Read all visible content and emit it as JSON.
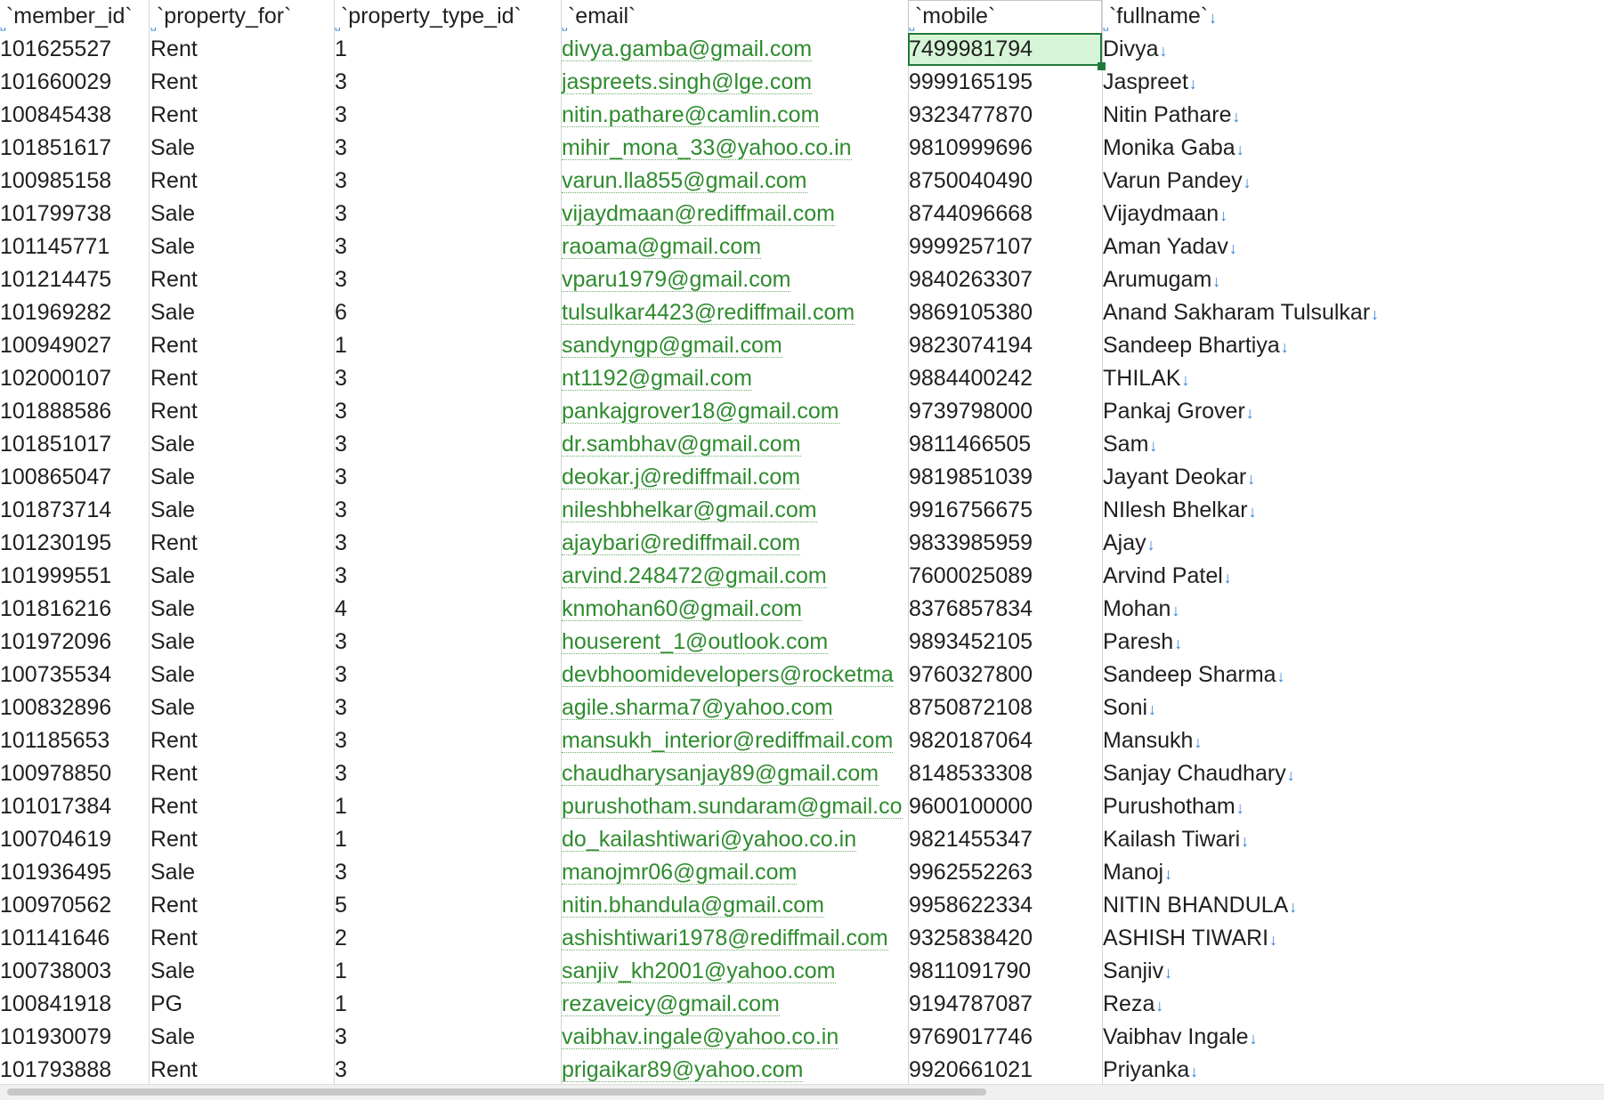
{
  "headers": {
    "member_id": "`member_id`",
    "property_for": "`property_for`",
    "property_type_id": "`property_type_id`",
    "email": "`email`",
    "mobile": "`mobile`",
    "fullname": "`fullname`"
  },
  "markers": {
    "space": "␣",
    "line_break": "↓"
  },
  "colors": {
    "email_text": "#2e8b2e",
    "selected_fill": "#d6f5d6",
    "selected_border": "#1f7a3a",
    "whitespace_marker": "#2f7fd6"
  },
  "selected_cell": {
    "row": 1,
    "column": "mobile"
  },
  "rows": [
    {
      "member_id": "101625527",
      "property_for": "Rent",
      "property_type_id": "1",
      "email": "divya.gamba@gmail.com",
      "mobile": "7499981794",
      "fullname": "Divya"
    },
    {
      "member_id": "101660029",
      "property_for": "Rent",
      "property_type_id": "3",
      "email": "jaspreets.singh@lge.com",
      "mobile": "9999165195",
      "fullname": "Jaspreet"
    },
    {
      "member_id": "100845438",
      "property_for": "Rent",
      "property_type_id": "3",
      "email": "nitin.pathare@camlin.com",
      "mobile": "9323477870",
      "fullname": "Nitin Pathare"
    },
    {
      "member_id": "101851617",
      "property_for": "Sale",
      "property_type_id": "3",
      "email": "mihir_mona_33@yahoo.co.in",
      "mobile": "9810999696",
      "fullname": "Monika Gaba"
    },
    {
      "member_id": "100985158",
      "property_for": "Rent",
      "property_type_id": "3",
      "email": "varun.lla855@gmail.com",
      "mobile": "8750040490",
      "fullname": "Varun  Pandey"
    },
    {
      "member_id": "101799738",
      "property_for": "Sale",
      "property_type_id": "3",
      "email": "vijaydmaan@rediffmail.com",
      "mobile": "8744096668",
      "fullname": "Vijaydmaan"
    },
    {
      "member_id": "101145771",
      "property_for": "Sale",
      "property_type_id": "3",
      "email": "raoama@gmail.com",
      "mobile": "9999257107",
      "fullname": "Aman Yadav"
    },
    {
      "member_id": "101214475",
      "property_for": "Rent",
      "property_type_id": "3",
      "email": "vparu1979@gmail.com",
      "mobile": "9840263307",
      "fullname": "Arumugam"
    },
    {
      "member_id": "101969282",
      "property_for": "Sale",
      "property_type_id": "6",
      "email": "tulsulkar4423@rediffmail.com",
      "mobile": "9869105380",
      "fullname": "Anand Sakharam Tulsulkar"
    },
    {
      "member_id": "100949027",
      "property_for": "Rent",
      "property_type_id": "1",
      "email": "sandyngp@gmail.com",
      "mobile": "9823074194",
      "fullname": "Sandeep Bhartiya"
    },
    {
      "member_id": "102000107",
      "property_for": "Rent",
      "property_type_id": "3",
      "email": "nt1192@gmail.com",
      "mobile": "9884400242",
      "fullname": "THILAK"
    },
    {
      "member_id": "101888586",
      "property_for": "Rent",
      "property_type_id": "3",
      "email": "pankajgrover18@gmail.com",
      "mobile": "9739798000",
      "fullname": "Pankaj Grover"
    },
    {
      "member_id": "101851017",
      "property_for": "Sale",
      "property_type_id": "3",
      "email": "dr.sambhav@gmail.com",
      "mobile": "9811466505",
      "fullname": "Sam"
    },
    {
      "member_id": "100865047",
      "property_for": "Sale",
      "property_type_id": "3",
      "email": "deokar.j@rediffmail.com",
      "mobile": "9819851039",
      "fullname": "Jayant Deokar"
    },
    {
      "member_id": "101873714",
      "property_for": "Sale",
      "property_type_id": "3",
      "email": "nileshbhelkar@gmail.com",
      "mobile": "9916756675",
      "fullname": "NIlesh Bhelkar"
    },
    {
      "member_id": "101230195",
      "property_for": "Rent",
      "property_type_id": "3",
      "email": "ajaybari@rediffmail.com",
      "mobile": "9833985959",
      "fullname": "Ajay"
    },
    {
      "member_id": "101999551",
      "property_for": "Sale",
      "property_type_id": "3",
      "email": "arvind.248472@gmail.com",
      "mobile": "7600025089",
      "fullname": "Arvind Patel"
    },
    {
      "member_id": "101816216",
      "property_for": "Sale",
      "property_type_id": "4",
      "email": "knmohan60@gmail.com",
      "mobile": "8376857834",
      "fullname": "Mohan"
    },
    {
      "member_id": "101972096",
      "property_for": "Sale",
      "property_type_id": "3",
      "email": "houserent_1@outlook.com",
      "mobile": "9893452105",
      "fullname": "Paresh"
    },
    {
      "member_id": "100735534",
      "property_for": "Sale",
      "property_type_id": "3",
      "email": "devbhoomidevelopers@rocketma",
      "mobile": "9760327800",
      "fullname": "Sandeep Sharma"
    },
    {
      "member_id": "100832896",
      "property_for": "Sale",
      "property_type_id": "3",
      "email": "agile.sharma7@yahoo.com",
      "mobile": "8750872108",
      "fullname": "Soni"
    },
    {
      "member_id": "101185653",
      "property_for": "Rent",
      "property_type_id": "3",
      "email": "mansukh_interior@rediffmail.com",
      "mobile": "9820187064",
      "fullname": "Mansukh"
    },
    {
      "member_id": "100978850",
      "property_for": "Rent",
      "property_type_id": "3",
      "email": "chaudharysanjay89@gmail.com",
      "mobile": "8148533308",
      "fullname": "Sanjay Chaudhary"
    },
    {
      "member_id": "101017384",
      "property_for": "Rent",
      "property_type_id": "1",
      "email": "purushotham.sundaram@gmail.co",
      "mobile": "9600100000",
      "fullname": "Purushotham"
    },
    {
      "member_id": "100704619",
      "property_for": "Rent",
      "property_type_id": "1",
      "email": "do_kailashtiwari@yahoo.co.in",
      "mobile": "9821455347",
      "fullname": "Kailash Tiwari"
    },
    {
      "member_id": "101936495",
      "property_for": "Sale",
      "property_type_id": "3",
      "email": "manojmr06@gmail.com",
      "mobile": "9962552263",
      "fullname": "Manoj"
    },
    {
      "member_id": "100970562",
      "property_for": "Rent",
      "property_type_id": "5",
      "email": "nitin.bhandula@gmail.com",
      "mobile": "9958622334",
      "fullname": "NITIN BHANDULA"
    },
    {
      "member_id": "101141646",
      "property_for": "Rent",
      "property_type_id": "2",
      "email": "ashishtiwari1978@rediffmail.com",
      "mobile": "9325838420",
      "fullname": "ASHISH TIWARI"
    },
    {
      "member_id": "100738003",
      "property_for": "Sale",
      "property_type_id": "1",
      "email": "sanjiv_kh2001@yahoo.com",
      "mobile": "9811091790",
      "fullname": "Sanjiv"
    },
    {
      "member_id": "100841918",
      "property_for": "PG",
      "property_type_id": "1",
      "email": "rezaveicy@gmail.com",
      "mobile": "9194787087",
      "fullname": "Reza"
    },
    {
      "member_id": "101930079",
      "property_for": "Sale",
      "property_type_id": "3",
      "email": "vaibhav.ingale@yahoo.co.in",
      "mobile": "9769017746",
      "fullname": "Vaibhav Ingale"
    },
    {
      "member_id": "101793888",
      "property_for": "Rent",
      "property_type_id": "3",
      "email": "prigaikar89@yahoo.com",
      "mobile": "9920661021",
      "fullname": "Priyanka"
    }
  ]
}
